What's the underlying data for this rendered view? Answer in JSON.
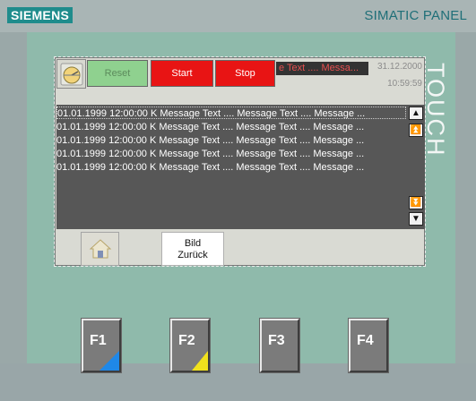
{
  "panel": {
    "brand": "SIEMENS",
    "model": "SIMATIC PANEL",
    "touch_label": "TOUCH"
  },
  "toolbar": {
    "logo_icon": "gauge-logo-icon",
    "reset_label": "Reset",
    "start_label": "Start",
    "stop_label": "Stop",
    "marquee_text": "e Text .... Messa...",
    "date": "31.12.2000",
    "time": "10:59:59",
    "colors": {
      "reset": "#8fd18f",
      "start": "#e81414",
      "stop": "#e81414",
      "marquee_text": "#e65050"
    }
  },
  "alarm_view": {
    "rows": [
      {
        "text": "01.01.1999 12:00:00 K Message Text .... Message Text .... Message ..."
      },
      {
        "text": "01.01.1999 12:00:00 K Message Text .... Message Text .... Message ..."
      },
      {
        "text": "01.01.1999 12:00:00 K Message Text .... Message Text .... Message ..."
      },
      {
        "text": "01.01.1999 12:00:00 K Message Text .... Message Text .... Message ..."
      },
      {
        "text": "01.01.1999 12:00:00 K Message Text .... Message Text .... Message ..."
      }
    ],
    "scroll": {
      "line_up_glyph": "▲",
      "page_up_glyph": "⏫",
      "page_down_glyph": "⏬",
      "line_down_glyph": "▼"
    }
  },
  "nav": {
    "home_icon": "home-icon",
    "back_label_line1": "Bild",
    "back_label_line2": "Zurück"
  },
  "function_keys": [
    {
      "label": "F1",
      "corner_color": "#1f88e8"
    },
    {
      "label": "F2",
      "corner_color": "#f1e21d"
    },
    {
      "label": "F3"
    },
    {
      "label": "F4"
    }
  ]
}
